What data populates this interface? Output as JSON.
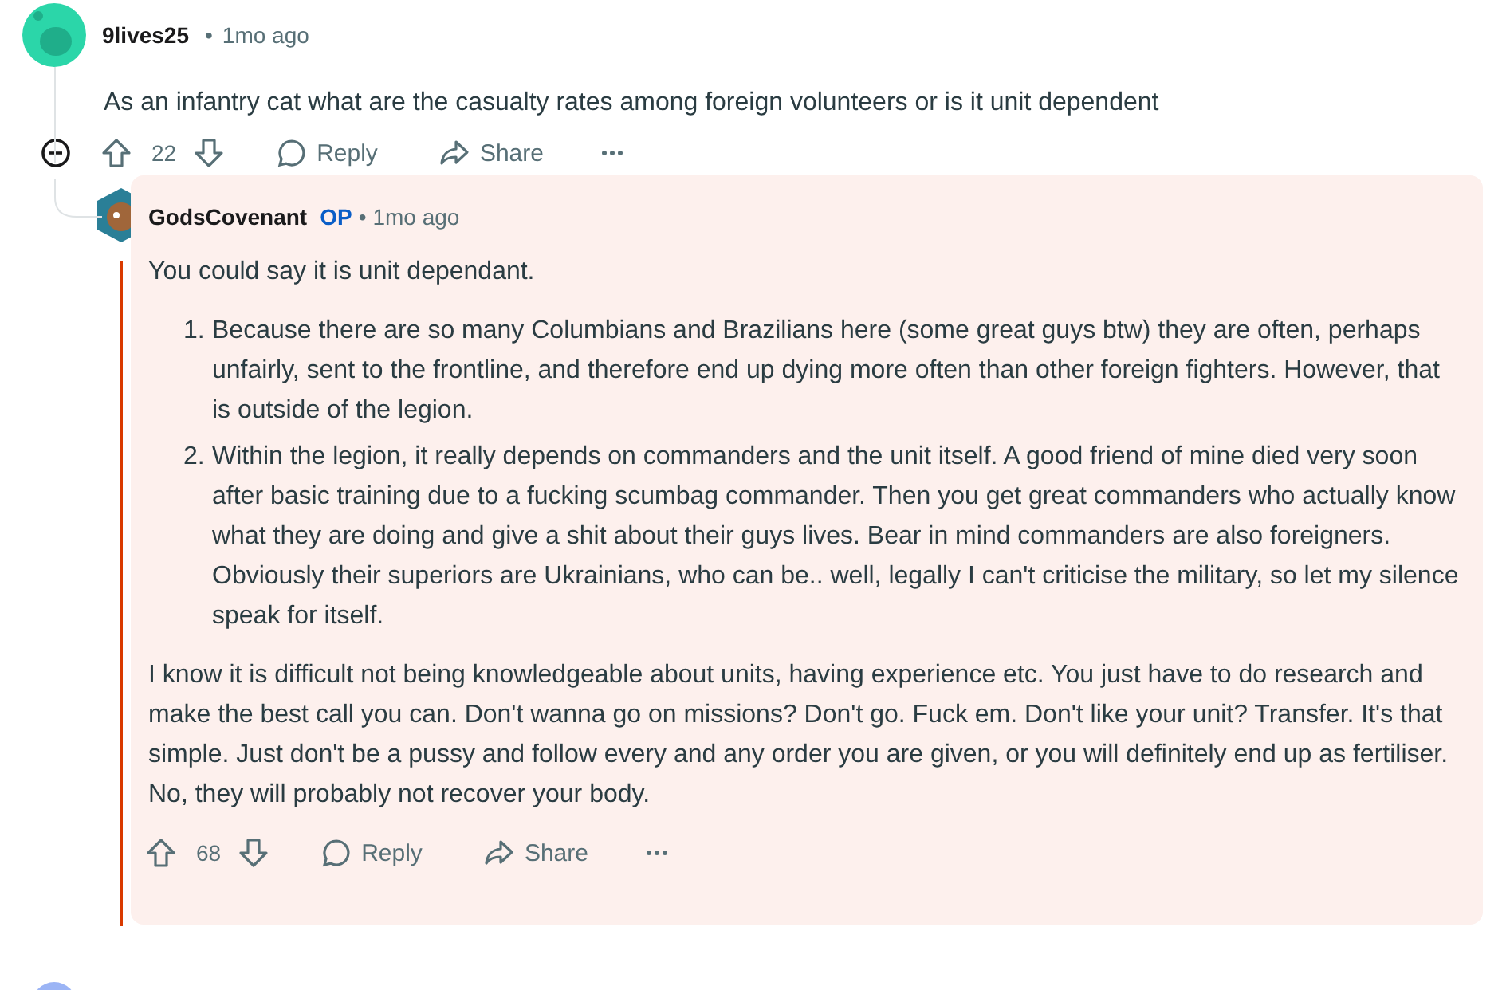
{
  "comment": {
    "author": "9lives25",
    "separator": "•",
    "time": "1mo ago",
    "body": "As an infantry cat what are the casualty rates among foreign volunteers or is it unit dependent",
    "votes": "22",
    "reply_label": "Reply",
    "share_label": "Share"
  },
  "reply": {
    "author": "GodsCovenant",
    "badge": "OP",
    "separator": "•",
    "time": "1mo ago",
    "intro": "You could say it is unit dependant.",
    "points": [
      {
        "marker": "1.",
        "text": "Because there are so many Columbians and Brazilians here (some great guys btw) they are often, perhaps unfairly, sent to the frontline, and therefore end up dying more often than other foreign fighters. However, that is outside of the legion."
      },
      {
        "marker": "2.",
        "text": "Within the legion, it really depends on commanders and the unit itself. A good friend of mine died very soon after basic training due to a fucking scumbag commander. Then you get great commanders who actually know what they are doing and give a shit about their guys lives. Bear in mind commanders are also foreigners. Obviously their superiors are Ukrainians, who can be.. well, legally I can't criticise the military, so let my silence speak for itself."
      }
    ],
    "closing": "I know it is difficult not being knowledgeable about units, having experience etc. You just have to do research and make the best call you can. Don't wanna go on missions? Don't go. Fuck em. Don't like your unit? Transfer. It's that simple. Just don't be a pussy and follow every and any order you are given, or you will definitely end up as fertiliser. No, they will probably not recover your body.",
    "votes": "68",
    "reply_label": "Reply",
    "share_label": "Share",
    "highlighted": true
  }
}
